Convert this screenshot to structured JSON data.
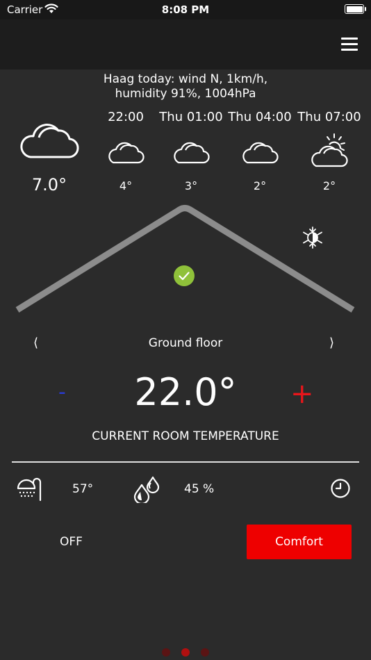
{
  "status_bar": {
    "carrier": "Carrier",
    "time": "8:08 PM"
  },
  "weather": {
    "summary_line1": "Haag today: wind N, 1km/h,",
    "summary_line2": "humidity 91%, 1004hPa",
    "current": {
      "temp": "7.0°",
      "icon": "cloud-icon"
    },
    "forecast": [
      {
        "time": "22:00",
        "temp": "4°",
        "icon": "cloud-icon"
      },
      {
        "time": "Thu 01:00",
        "temp": "3°",
        "icon": "cloud-icon"
      },
      {
        "time": "Thu 04:00",
        "temp": "2°",
        "icon": "cloud-icon"
      },
      {
        "time": "Thu 07:00",
        "temp": "2°",
        "icon": "partly-sunny-icon"
      }
    ]
  },
  "room": {
    "prev_glyph": "⟨",
    "next_glyph": "⟩",
    "floor_name": "Ground floor",
    "minus_label": "-",
    "plus_label": "+",
    "temperature": "22.0°",
    "temperature_label": "CURRENT ROOM TEMPERATURE"
  },
  "info": {
    "water_temp": "57°",
    "humidity": "45 %"
  },
  "mode": {
    "off_label": "OFF",
    "comfort_label": "Comfort"
  },
  "pager": {
    "count": 3,
    "active_index": 1
  },
  "colors": {
    "background": "#2b2b2b",
    "accent_red": "#ee0000",
    "minus_blue": "#2a3bd1",
    "check_green": "#8fc13a",
    "roof_gray": "#8c8c8c"
  }
}
